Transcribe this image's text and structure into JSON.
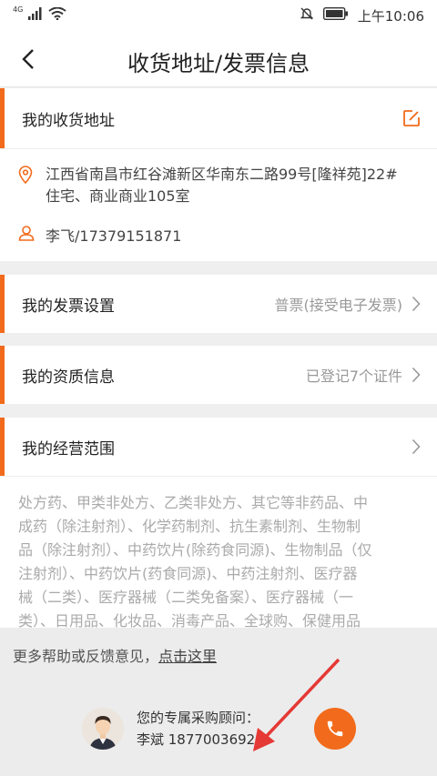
{
  "status_bar": {
    "network": "4G",
    "time": "上午10:06"
  },
  "nav": {
    "title": "收货地址/发票信息"
  },
  "shipping": {
    "header": "我的收货地址",
    "address_line1": "江西省南昌市红谷滩新区华南东二路99号[隆祥苑]22#",
    "address_line2": "住宅、商业商业105室",
    "contact": "李飞/17379151871"
  },
  "invoice": {
    "header": "我的发票设置",
    "value": "普票(接受电子发票)"
  },
  "qualification": {
    "header": "我的资质信息",
    "value": "已登记7个证件"
  },
  "business_scope": {
    "header": "我的经营范围",
    "lines": [
      "处方药、甲类非处方、乙类非处方、其它等非药品、中",
      "成药（除注射剂）、化学药制剂、抗生素制剂、生物制",
      "品（除注射剂）、中药饮片(除药食同源)、生物制品（仅",
      "注射剂）、中药饮片(药食同源)、中药注射剂、医疗器",
      "械（二类）、医疗器械（二类免备案）、医疗器械（一",
      "类）、日用品、化妆品、消毒产品、全球购、保健用品"
    ]
  },
  "help": {
    "text": "更多帮助或反馈意见，",
    "link": "点击这里"
  },
  "advisor": {
    "label": "您的专属采购顾问：",
    "name_phone": "李斌 18770036925"
  },
  "colors": {
    "accent": "#f26a1b",
    "annotation_arrow": "#e53935"
  }
}
